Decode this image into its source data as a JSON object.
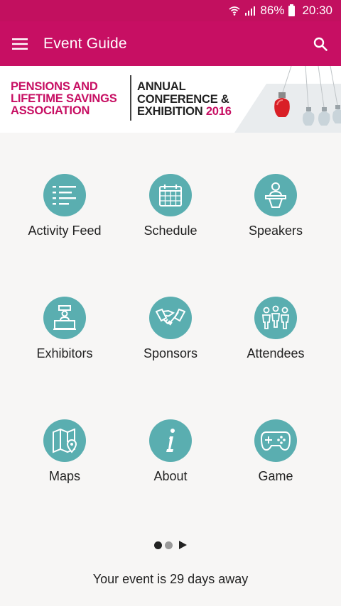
{
  "status_bar": {
    "battery_percent": "86%",
    "time": "20:30"
  },
  "app_bar": {
    "title": "Event Guide",
    "menu_icon": "hamburger-menu-icon",
    "search_icon": "search-icon"
  },
  "banner": {
    "org_line1": "PENSIONS AND",
    "org_line2": "LIFETIME SAVINGS",
    "org_line3": "ASSOCIATION",
    "conf_line1": "ANNUAL",
    "conf_line2": "CONFERENCE &",
    "conf_line3": "EXHIBITION",
    "conf_year": "2016"
  },
  "tiles": [
    {
      "label": "Activity Feed",
      "icon": "list-icon"
    },
    {
      "label": "Schedule",
      "icon": "calendar-icon"
    },
    {
      "label": "Speakers",
      "icon": "speaker-podium-icon"
    },
    {
      "label": "Exhibitors",
      "icon": "booth-icon"
    },
    {
      "label": "Sponsors",
      "icon": "handshake-icon"
    },
    {
      "label": "Attendees",
      "icon": "group-icon"
    },
    {
      "label": "Maps",
      "icon": "map-icon"
    },
    {
      "label": "About",
      "icon": "info-icon"
    },
    {
      "label": "Game",
      "icon": "gamepad-icon"
    }
  ],
  "pager": {
    "pages": 2,
    "current_page": 1
  },
  "countdown": "Your event is 29 days away",
  "colors": {
    "primary": "#c70f63",
    "status_bar": "#c2105f",
    "tile_circle": "#5aaeb0",
    "background": "#f7f6f5"
  }
}
